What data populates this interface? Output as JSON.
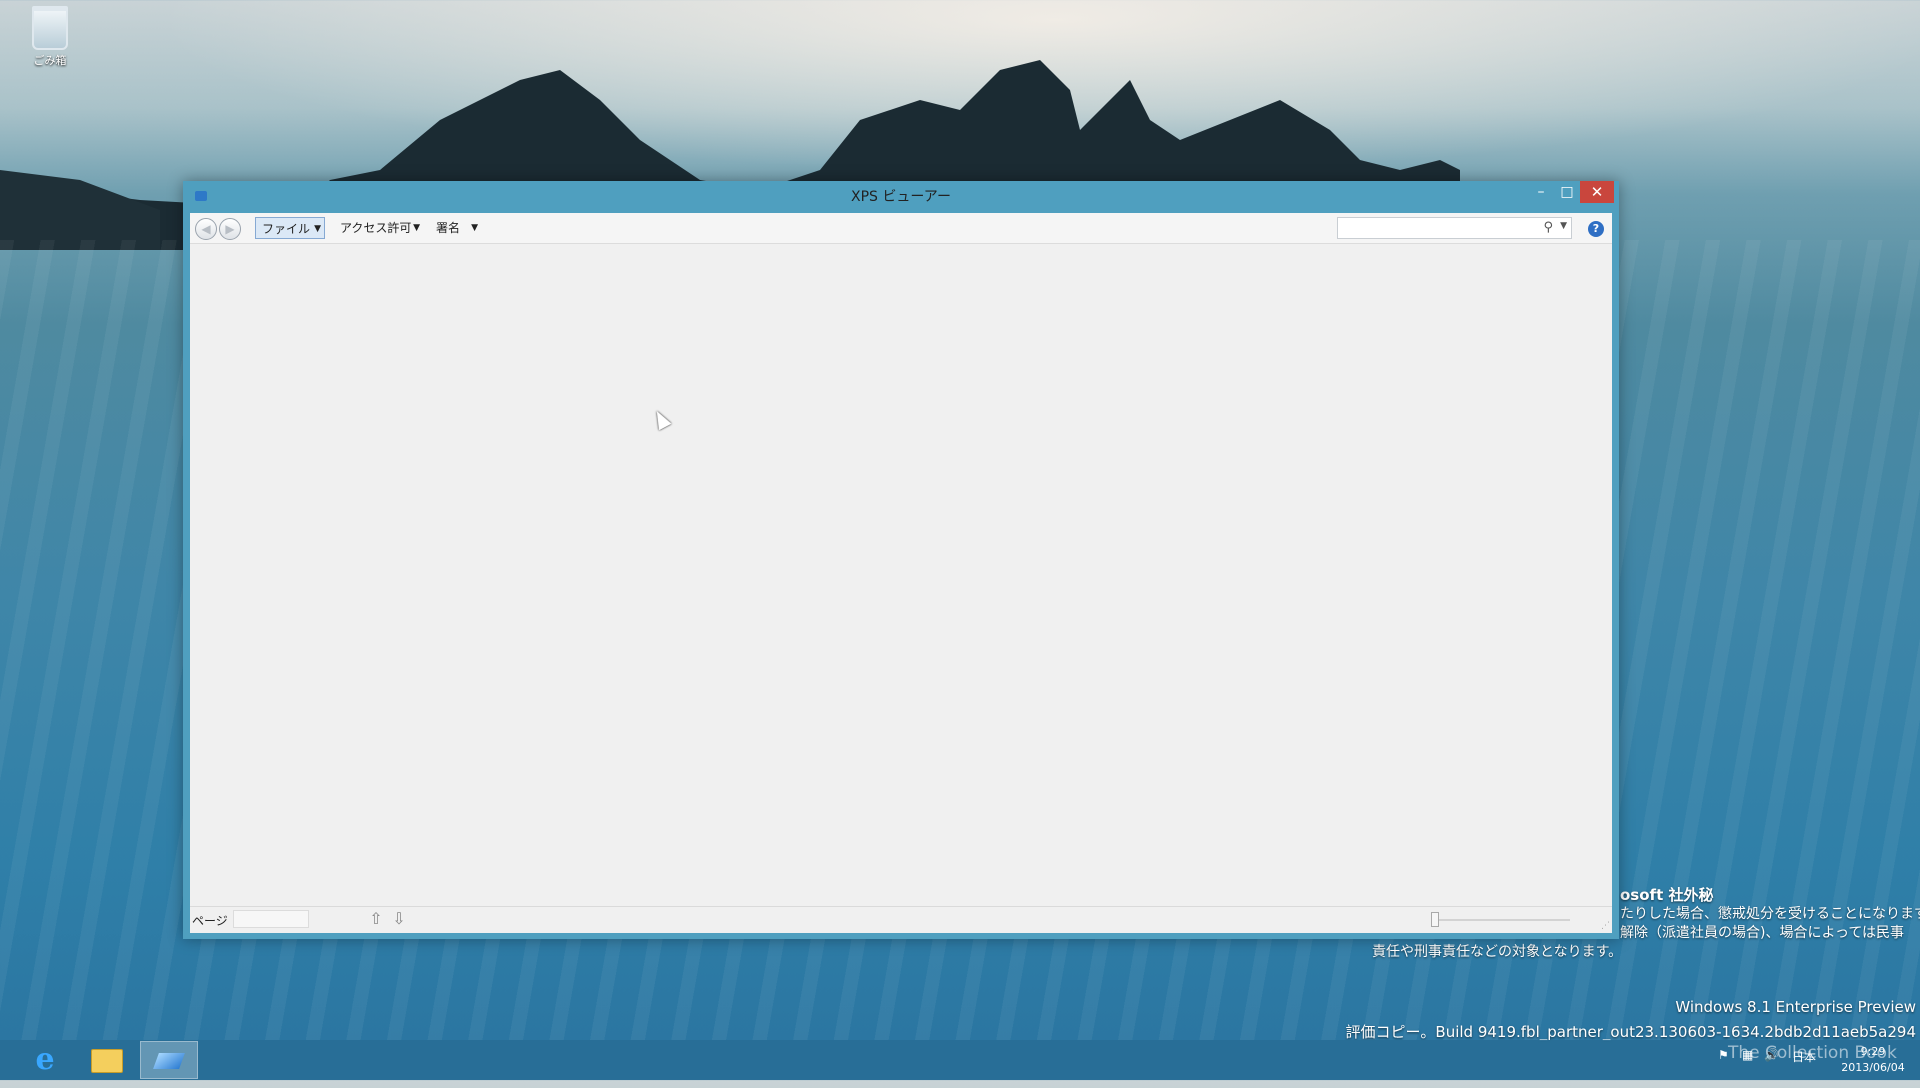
{
  "desktop": {
    "recycle_bin_label": "ごみ箱"
  },
  "window": {
    "title": "XPS ビューアー",
    "controls": {
      "minimize": "–",
      "maximize": "□",
      "close": "✕"
    },
    "toolbar": {
      "back": "◀",
      "forward": "▶",
      "menus": [
        "ファイル",
        "アクセス許可",
        "署名"
      ],
      "dropdown_glyph": "▼",
      "search_placeholder": "",
      "search_glyph": "⚲",
      "help_glyph": "?"
    },
    "statusbar": {
      "page_label": "ページ",
      "page_value": "",
      "up_glyph": "⇧",
      "down_glyph": "⇩",
      "grip_glyph": "⋰"
    }
  },
  "watermark": {
    "confidential": "osoft 社外秘",
    "line1": "たりした場合、懲戒処分を受けることになります。こ",
    "line2": "解除（派遣社員の場合)、場合によっては民事",
    "line3": "責任や刑事責任などの対象となります。",
    "version": "Windows 8.1 Enterprise Preview",
    "build": "評価コピー。Build 9419.fbl_partner_out23.130603-1634.2bdb2d11aeb5a294"
  },
  "taskbar": {
    "ie_glyph": "e",
    "tray_ime": "日本",
    "clock_time": "9:29",
    "clock_date": "2013/06/04",
    "overlay_text": "The Collection Book"
  },
  "colors": {
    "window_frame": "#4f9fbf",
    "close_button": "#c9463d",
    "file_menu_highlight": "#dbe8f6"
  }
}
